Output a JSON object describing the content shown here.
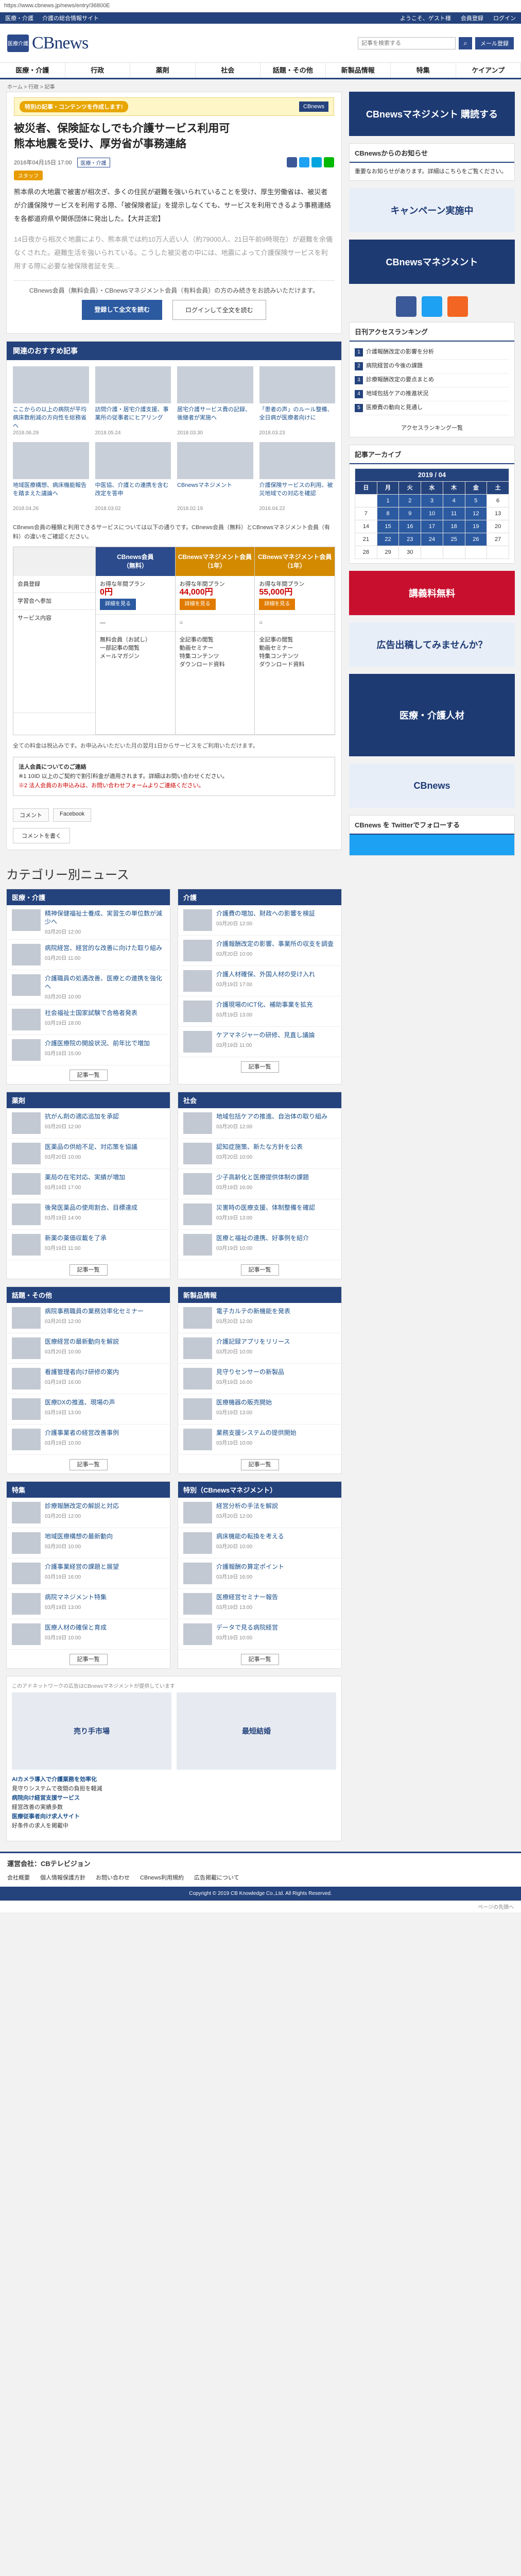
{
  "browser": {
    "url": "https://www.cbnews.jp/news/entry/36800E"
  },
  "topbar": {
    "links": [
      "医療・介護",
      "介護の総合情報サイト"
    ],
    "welcome": "ようこそ、ゲスト様",
    "register": "会員登録",
    "login": "ログイン"
  },
  "header": {
    "logo_mark": "医療介護",
    "logo_text": "CBnews",
    "search_placeholder": "記事を検索する",
    "mail_button": "メール登録"
  },
  "nav": [
    "医療・介護",
    "行政",
    "薬剤",
    "社会",
    "話題・その他",
    "新製品情報",
    "特集",
    "ケイアンプ"
  ],
  "breadcrumb": "ホーム > 行政 > 記事",
  "article": {
    "special_label": "特別の記事・コンテンツを作成します!",
    "special_logo": "CBnews",
    "title": "被災者、保険証なしでも介護サービス利用可\n熊本地震を受け、厚労省が事務連絡",
    "date": "2016年04月15日 17:00",
    "tag": "医療・介護",
    "staff": "スタッフ",
    "paragraphs": [
      "熊本県の大地震で被害が相次ぎ、多くの住民が避難を強いられていることを受け、厚生労働省は、被災者が介護保険サービスを利用する際、「被保険者証」を提示しなくても、サービスを利用できるよう事務連絡を各都道府県や関係団体に発出した。【大井正宏】",
      "14日夜から相次ぐ地震により、熊本県では約10万人近い人（約79000人、21日午前9時現在）が避難を余儀なくされた。避難生活を強いられている。こうした被災者の中には、地震によって介護保険サービスを利用する際に必要な被保険者証を失..."
    ],
    "reg_text": "CBnews会員（無料会員）・CBnewsマネジメント会員（有料会員）の方のみ続きをお読みいただけます。",
    "register_button": "登録して全文を読む",
    "login_button": "ログインして全文を読む"
  },
  "recommended": {
    "heading": "関連のおすすめ記事",
    "items": [
      {
        "title": "ここからの以上の病院が平均病床数削減の方向性を総務省へ",
        "date": "2018.06.29"
      },
      {
        "title": "訪問介護・居宅介護支援、事業所の従事者にヒアリング",
        "date": "2018.05.24"
      },
      {
        "title": "居宅介護サービス費の記録、後継者が実施へ",
        "date": "2018.03.30"
      },
      {
        "title": "「患者の声」のルール整備、全日病が医療者向けに",
        "date": "2018.03.23"
      },
      {
        "title": "地域医療構想、病床機能報告を踏まえた議論へ",
        "date": "2018.04.26"
      },
      {
        "title": "中医協、介護との連携を含む改定を答申",
        "date": "2018.03.02"
      },
      {
        "title": "CBnewsマネジメント",
        "date": "2018.02.19"
      },
      {
        "title": "介護保険サービスの利用、被災地域での対応を確認",
        "date": "2016.04.22"
      }
    ]
  },
  "compare": {
    "intro": "CBnews会員の種類と利用できるサービスについては以下の通りです。CBnews会員（無料）とCBnewsマネジメント会員（有料）の違いをご確認ください。",
    "header_free": "CBnews会員",
    "header_mgmt": "CBnewsマネジメント会員",
    "header_mgmt2": "CBnewsマネジメント会員",
    "free_sub": "（無料）",
    "mgmt_sub": "（1年）",
    "mgmt2_sub": "（1年）",
    "price_label": "お得な年間プラン",
    "price_free": "0円",
    "price1": "44,000円",
    "price2": "55,000円",
    "col_left": [
      "会員登録",
      "学習会へ参加",
      "サービス内容"
    ],
    "free_items": [
      "無料会員（お試し）",
      "一部記事の閲覧",
      "メールマガジン"
    ],
    "mgmt_items": [
      "全記事の閲覧",
      "動画セミナー",
      "特集コンテンツ",
      "ダウンロード資料"
    ],
    "apply": "詳細を見る",
    "note": "全ての料金は税込みです。お申込みいただいた月の翌月1日からサービスをご利用いただけます。"
  },
  "corporate": {
    "heading": "法人会員についてのご連絡",
    "text": "※1 10ID 以上のご契約で割引料金が適用されます。詳細はお問い合わせください。",
    "red": "※2 法人会員のお申込みは、お問い合わせフォームよりご連絡ください。"
  },
  "comment": {
    "comment_label": "コメント",
    "fb_label": "Facebook",
    "more": "コメントを書く"
  },
  "categories": {
    "title": "カテゴリー別ニュース",
    "boxes": [
      {
        "name": "医療・介護",
        "items": [
          {
            "t": "精神保健福祉士養成、実習生の単位数が減少へ",
            "d": "03月20日 12:00"
          },
          {
            "t": "病院経営、経営的な改善に向けた取り組み",
            "d": "03月20日 11:00"
          },
          {
            "t": "介護職員の処遇改善、医療との連携を強化へ",
            "d": "03月20日 10:00"
          },
          {
            "t": "社会福祉士国家試験で合格者発表",
            "d": "03月19日 18:00"
          },
          {
            "t": "介護医療院の開設状況、前年比で増加",
            "d": "03月19日 15:00"
          }
        ]
      },
      {
        "name": "介護",
        "items": [
          {
            "t": "介護費の増加、財政への影響を検証",
            "d": "03月20日 12:00"
          },
          {
            "t": "介護報酬改定の影響、事業所の収支を調査",
            "d": "03月20日 10:00"
          },
          {
            "t": "介護人材確保、外国人材の受け入れ",
            "d": "03月19日 17:00"
          },
          {
            "t": "介護現場のICT化、補助事業を拡充",
            "d": "03月19日 13:00"
          },
          {
            "t": "ケアマネジャーの研修、見直し議論",
            "d": "03月19日 11:00"
          }
        ]
      },
      {
        "name": "薬剤",
        "items": [
          {
            "t": "抗がん剤の適応追加を承認",
            "d": "03月20日 12:00"
          },
          {
            "t": "医薬品の供給不足、対応策を協議",
            "d": "03月20日 10:00"
          },
          {
            "t": "薬局の在宅対応、実績が増加",
            "d": "03月19日 17:00"
          },
          {
            "t": "後発医薬品の使用割合、目標達成",
            "d": "03月19日 14:00"
          },
          {
            "t": "新薬の薬価収載を了承",
            "d": "03月19日 11:00"
          }
        ]
      },
      {
        "name": "社会",
        "items": [
          {
            "t": "地域包括ケアの推進、自治体の取り組み",
            "d": "03月20日 12:00"
          },
          {
            "t": "認知症施策、新たな方針を公表",
            "d": "03月20日 10:00"
          },
          {
            "t": "少子高齢化と医療提供体制の課題",
            "d": "03月19日 16:00"
          },
          {
            "t": "災害時の医療支援、体制整備を確認",
            "d": "03月19日 13:00"
          },
          {
            "t": "医療と福祉の連携、好事例を紹介",
            "d": "03月19日 10:00"
          }
        ]
      },
      {
        "name": "話題・その他",
        "items": [
          {
            "t": "病院事務職員の業務効率化セミナー",
            "d": "03月20日 12:00"
          },
          {
            "t": "医療経営の最新動向を解説",
            "d": "03月20日 10:00"
          },
          {
            "t": "看護管理者向け研修の案内",
            "d": "03月19日 16:00"
          },
          {
            "t": "医療DXの推進、現場の声",
            "d": "03月19日 13:00"
          },
          {
            "t": "介護事業者の経営改善事例",
            "d": "03月19日 10:00"
          }
        ]
      },
      {
        "name": "新製品情報",
        "items": [
          {
            "t": "電子カルテの新機能を発表",
            "d": "03月20日 12:00"
          },
          {
            "t": "介護記録アプリをリリース",
            "d": "03月20日 10:00"
          },
          {
            "t": "見守りセンサーの新製品",
            "d": "03月19日 16:00"
          },
          {
            "t": "医療機器の販売開始",
            "d": "03月19日 13:00"
          },
          {
            "t": "業務支援システムの提供開始",
            "d": "03月19日 10:00"
          }
        ]
      },
      {
        "name": "特集",
        "items": [
          {
            "t": "診療報酬改定の解説と対応",
            "d": "03月20日 12:00"
          },
          {
            "t": "地域医療構想の最新動向",
            "d": "03月20日 10:00"
          },
          {
            "t": "介護事業経営の課題と展望",
            "d": "03月19日 16:00"
          },
          {
            "t": "病院マネジメント特集",
            "d": "03月19日 13:00"
          },
          {
            "t": "医療人材の確保と育成",
            "d": "03月19日 10:00"
          }
        ]
      },
      {
        "name": "特別（CBnewsマネジメント）",
        "items": [
          {
            "t": "経営分析の手法を解説",
            "d": "03月20日 12:00"
          },
          {
            "t": "病床機能の転換を考える",
            "d": "03月20日 10:00"
          },
          {
            "t": "介護報酬の算定ポイント",
            "d": "03月19日 16:00"
          },
          {
            "t": "医療経営セミナー報告",
            "d": "03月19日 13:00"
          },
          {
            "t": "データで見る病院経営",
            "d": "03月19日 10:00"
          }
        ]
      }
    ],
    "more": "記事一覧"
  },
  "ads": {
    "label": "このアドネットワークの広告はCBnewsマネジメントが提供しています",
    "ad1": "売り手市場",
    "ad2": "最短結婚",
    "text_ads": [
      {
        "h": "AIカメラ導入で介護業務を効率化",
        "b": "見守りシステムで夜間の負担を軽減"
      },
      {
        "h": "病院向け経営支援サービス",
        "b": "経営改善の実績多数"
      },
      {
        "h": "医療従事者向け求人サイト",
        "b": "好条件の求人を掲載中"
      }
    ]
  },
  "sidebar": {
    "banner1": "CBnewsマネジメント 購読する",
    "notice_heading": "CBnewsからのお知らせ",
    "notice": "重要なお知らせがあります。詳細はこちらをご覧ください。",
    "banner2": "キャンペーン実施中",
    "banner3": "CBnewsマネジメント",
    "ranking_heading": "日刊アクセスランキング",
    "ranking": [
      "介護報酬改定の影響を分析",
      "病院経営の今後の課題",
      "診療報酬改定の要点まとめ",
      "地域包括ケアの推進状況",
      "医療費の動向と見通し"
    ],
    "ranking_more": "アクセスランキング一覧",
    "archive_heading": "記事アーカイブ",
    "archive_month": "2019 / 04",
    "weekdays": [
      "日",
      "月",
      "火",
      "水",
      "木",
      "金",
      "土"
    ],
    "banner4": "講義料無料",
    "banner5": "広告出稿してみませんか？",
    "banner6": "医療・介護人材",
    "banner7": "CBnews",
    "follow": "CBnews を Twitterでフォローする"
  },
  "footer": {
    "heading": "運営会社：CBテレビジョン",
    "links": [
      "会社概要",
      "個人情報保護方針",
      "お問い合わせ",
      "CBnews利用規約",
      "広告掲載について"
    ],
    "copyright": "Copyright © 2019 CB Knowledge Co.,Ltd. All Rights Reserved.",
    "pagetop": "ページの先頭へ"
  }
}
